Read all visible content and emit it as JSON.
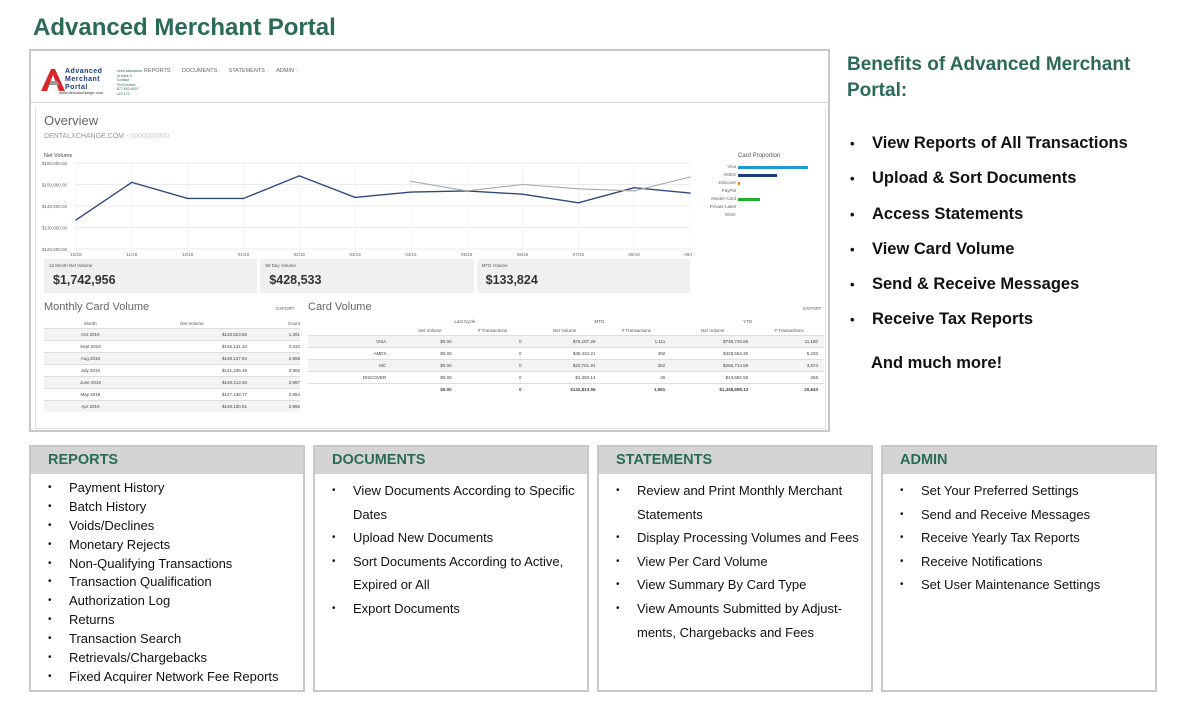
{
  "page_title": "Advanced Merchant Portal",
  "screenshot": {
    "logo": {
      "name_lines": [
        "Advanced",
        "Merchant",
        "Portal"
      ],
      "url": "www.dentalxchange.com",
      "contact_lines": [
        "need assistance",
        "or have a",
        "Contact",
        "ProConnect",
        "877-603-6007",
        "x27-172"
      ]
    },
    "nav": [
      "REPORTS ·",
      "DOCUMENTS ·",
      "STATEMENTS ·",
      "ADMIN ·"
    ],
    "overview_title": "Overview",
    "merchant_name": "DENTALXCHANGE.COM",
    "merchant_id": "- 0000000000",
    "net_volume_label": "Net Volume",
    "card_proportion": {
      "title": "Card Proportion",
      "items": [
        {
          "label": "Visa",
          "value": 1.0,
          "color": "#1f9ad6"
        },
        {
          "label": "AMEX",
          "value": 0.55,
          "color": "#1c3b7a"
        },
        {
          "label": "Discover",
          "value": 0.03,
          "color": "#f07a1a"
        },
        {
          "label": "PayPal",
          "value": 0.0,
          "color": "#999999"
        },
        {
          "label": "Master Card",
          "value": 0.32,
          "color": "#22b02a"
        },
        {
          "label": "Private Label",
          "value": 0.0,
          "color": "#999999"
        },
        {
          "label": "Other",
          "value": 0.0,
          "color": "#999999"
        }
      ]
    },
    "kpis": [
      {
        "label": "12 Month Net Volume",
        "value": "$1,742,956"
      },
      {
        "label": "90 Day Volume",
        "value": "$428,533"
      },
      {
        "label": "MTD Volume",
        "value": "$133,824"
      }
    ],
    "monthly": {
      "title": "Monthly Card Volume",
      "export": "EXPORT",
      "headers": [
        "Month",
        "Net Volume",
        "Count"
      ],
      "rows": [
        [
          "Oct 2019",
          "$133,823.55",
          "1,391"
        ],
        [
          "Sept 2019",
          "$146,131.34",
          "2,032"
        ],
        [
          "Aug 2019",
          "$148,137.84",
          "2,859"
        ],
        [
          "July 2019",
          "$141,335.49",
          "2,962"
        ],
        [
          "June 2019",
          "$146,213.46",
          "2,967"
        ],
        [
          "May 2019",
          "$147,138.77",
          "2,854"
        ],
        [
          "Apr 2019",
          "$146,100.01",
          "2,865"
        ]
      ]
    },
    "card_volume": {
      "title": "Card Volume",
      "export": "EXPORT",
      "groups": [
        "Last Cycle",
        "MTD",
        "YTD"
      ],
      "headers": [
        "Net Volume",
        "# Transactions",
        "Net Volume",
        "# Transactions",
        "Net Volume",
        "# Transactions"
      ],
      "rows": [
        [
          "VISA",
          "$0.00",
          "0",
          "$76,187.29",
          "1,111",
          "$749,746.65",
          "11,180"
        ],
        [
          "AMEX",
          "$0.00",
          "0",
          "$38,434.21",
          "492",
          "$428,554.30",
          "6,233"
        ],
        [
          "MC",
          "$0.00",
          "0",
          "$22,751.91",
          "362",
          "$256,714.59",
          "3,874"
        ],
        [
          "DISCOVER",
          "$0.00",
          "0",
          "$1,450.14",
          "26",
          "$13,682.59",
          "256"
        ]
      ],
      "total": [
        "",
        "$0.00",
        "0",
        "$132,823.55",
        "1,991",
        "$1,448,698.13",
        "20,643"
      ]
    }
  },
  "chart_data": {
    "type": "line",
    "title": "",
    "ylabel": "Net Volume",
    "ylim": [
      120000,
      160000
    ],
    "yticks": [
      "$160,000.00",
      "$150,000.00",
      "$140,000.00",
      "$130,000.00",
      "$120,000.00"
    ],
    "categories": [
      "10/18",
      "11/18",
      "12/18",
      "01/19",
      "02/19",
      "03/19",
      "04/19",
      "05/19",
      "06/19",
      "07/19",
      "08/19",
      "09/19"
    ],
    "grid": true,
    "series": [
      {
        "color": "#2c4a7e",
        "values": [
          133500,
          151000,
          143500,
          143500,
          154000,
          144000,
          146500,
          147000,
          145500,
          141500,
          148500,
          146000
        ]
      },
      {
        "color": "#a8a8a8",
        "values": [
          null,
          null,
          null,
          null,
          null,
          null,
          151500,
          147000,
          150000,
          148000,
          147000,
          153500
        ]
      }
    ]
  },
  "benefits": {
    "title_lines": [
      "Benefits of Advanced Merchant",
      "Portal:"
    ],
    "items": [
      "View Reports of All Transactions",
      "Upload & Sort Documents",
      "Access Statements",
      "View Card Volume",
      "Send & Receive Messages",
      "Receive Tax Reports"
    ],
    "more": "And much more!"
  },
  "panels": {
    "reports": {
      "title": "REPORTS",
      "items": [
        "Payment History",
        "Batch History",
        "Voids/Declines",
        "Monetary Rejects",
        "Non-Qualifying Transactions",
        "Transaction Qualification",
        "Authorization Log",
        "Returns",
        "Transaction Search",
        "Retrievals/Chargebacks",
        "Fixed Acquirer Network Fee Reports"
      ]
    },
    "documents": {
      "title": "DOCUMENTS",
      "items": [
        "View Documents According to Specific Dates",
        "Upload New Documents",
        "Sort Documents According to Active, Expired or All",
        "Export Documents"
      ]
    },
    "statements": {
      "title": "STATEMENTS",
      "items": [
        "Review and Print Monthly Merchant Statements",
        "Display Processing Volumes and Fees",
        "View Per Card Volume",
        "View Summary By Card Type",
        "View Amounts Submitted by Adjust-ments, Chargebacks and Fees"
      ]
    },
    "admin": {
      "title": "ADMIN",
      "items": [
        "Set Your Preferred Settings",
        "Send and Receive Messages",
        "Receive Yearly Tax Reports",
        "Receive Notifications",
        "Set User Maintenance Settings"
      ]
    }
  }
}
